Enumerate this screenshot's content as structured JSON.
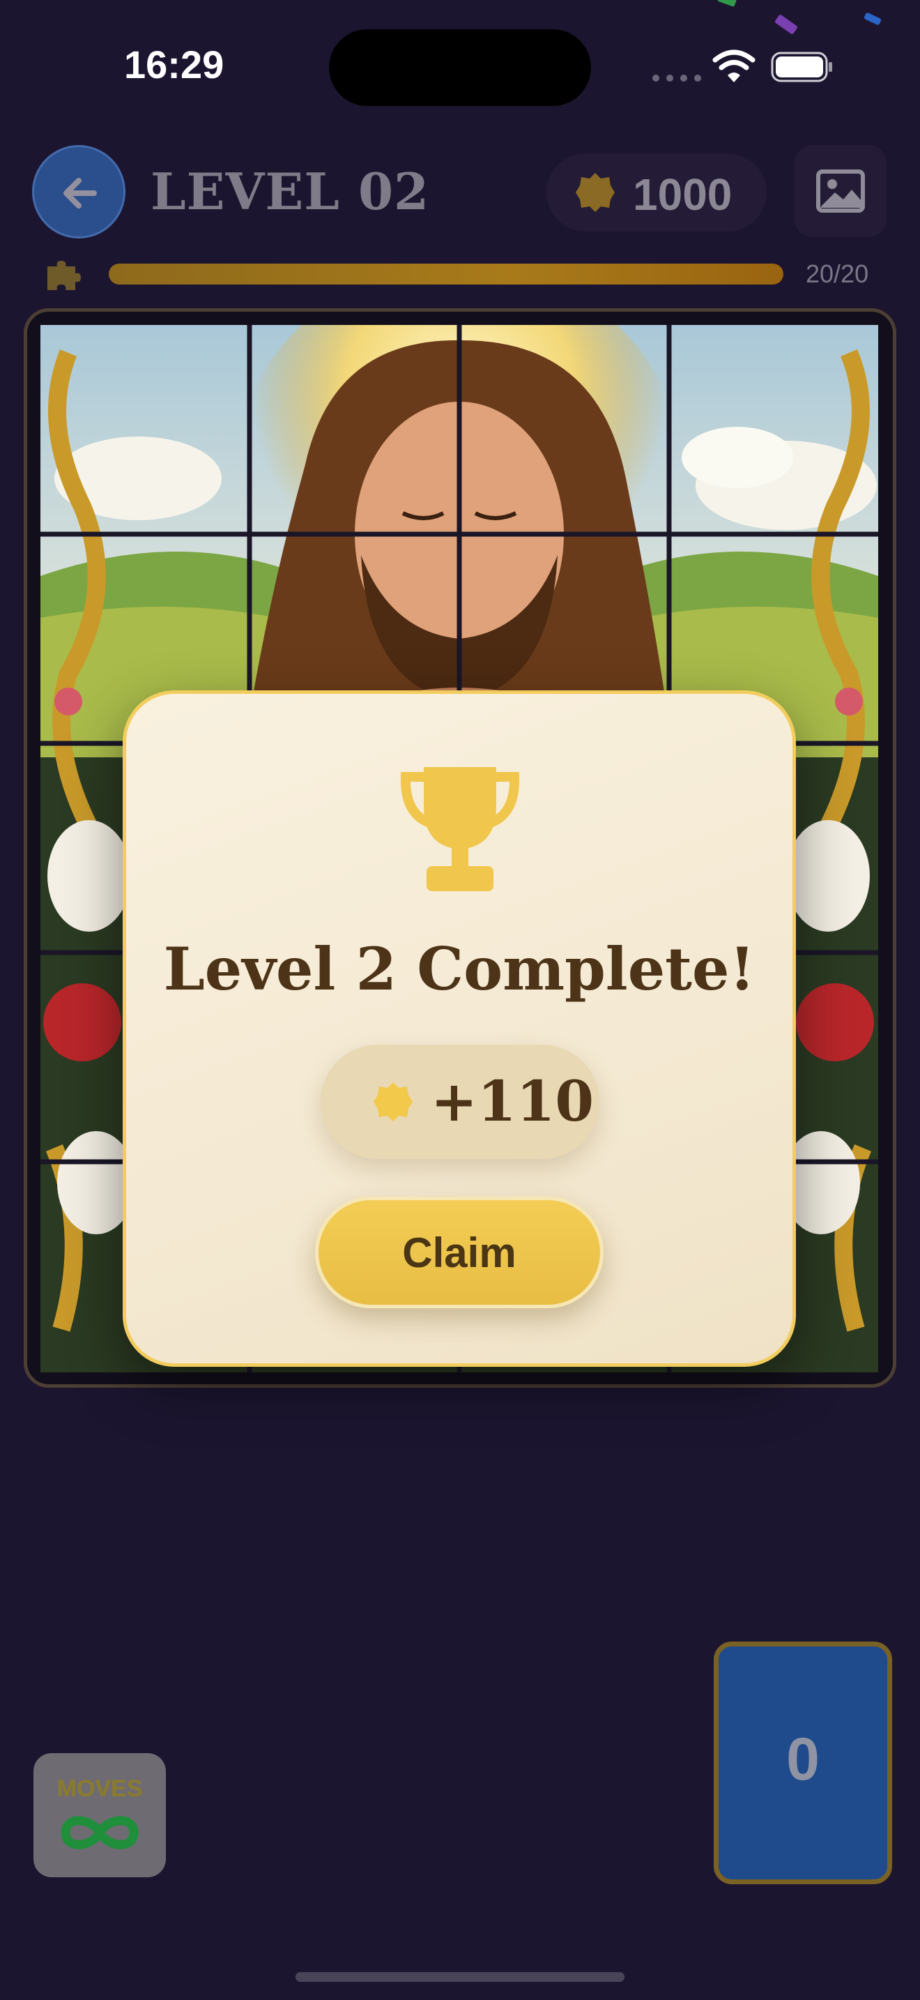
{
  "status_bar": {
    "time": "16:29"
  },
  "header": {
    "level_title": "LEVEL 02",
    "coins": "1000"
  },
  "progress": {
    "text": "20/20",
    "fraction": 1.0
  },
  "modal": {
    "title": "Level 2 Complete!",
    "reward": "+110",
    "claim_label": "Claim"
  },
  "bottom": {
    "moves_label": "MOVES",
    "moves_value": "∞",
    "counter": "0"
  },
  "icons": {
    "back": "arrow-left-icon",
    "coin": "coin-icon",
    "image": "image-icon",
    "puzzle": "puzzle-piece-icon",
    "trophy": "trophy-icon",
    "infinity": "infinity-icon"
  },
  "colors": {
    "background": "#1c1530",
    "accent_gold": "#f2cd5e",
    "modal_text": "#4d3318",
    "infinity_green": "#1f8f3c",
    "counter_blue": "#1f4a8c"
  }
}
